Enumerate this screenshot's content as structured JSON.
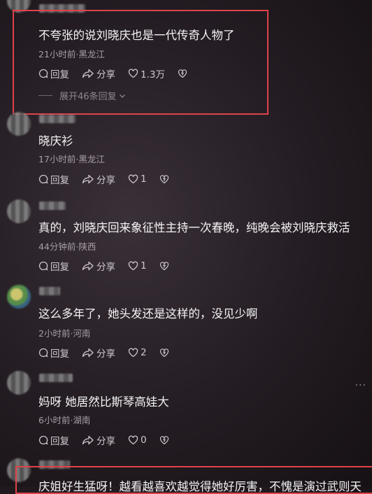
{
  "comments": [
    {
      "text": "不夸张的说刘晓庆也是一代传奇人物了",
      "meta": "21小时前·黑龙江",
      "reply": "回复",
      "share": "分享",
      "likes": "1.3万",
      "expand": "展开46条回复"
    },
    {
      "text": "晓庆衫",
      "meta": "17小时前·黑龙江",
      "reply": "回复",
      "share": "分享",
      "likes": "1"
    },
    {
      "text": "真的，刘晓庆回来象征性主持一次春晚，纯晚会被刘晓庆救活",
      "meta": "44分钟前·陕西",
      "reply": "回复",
      "share": "分享",
      "likes": "1"
    },
    {
      "text": "这么多年了，她头发还是这样的，没见少啊",
      "meta": "2小时前·河南",
      "reply": "回复",
      "share": "分享",
      "likes": "2"
    },
    {
      "text": "妈呀 她居然比斯琴高娃大",
      "meta": "6小时前·湖南",
      "reply": "回复",
      "share": "分享",
      "likes": "0"
    },
    {
      "text": "庆姐好生猛呀！越看越喜欢越觉得她好厉害，不愧是演过武则天"
    }
  ],
  "colors": {
    "highlight": "#e0424a",
    "background": "#231c22",
    "meta": "#a79ea6"
  },
  "icons": [
    "reply-icon",
    "share-icon",
    "heart-icon",
    "dislike-icon",
    "chevron-down-icon",
    "more-icon"
  ]
}
